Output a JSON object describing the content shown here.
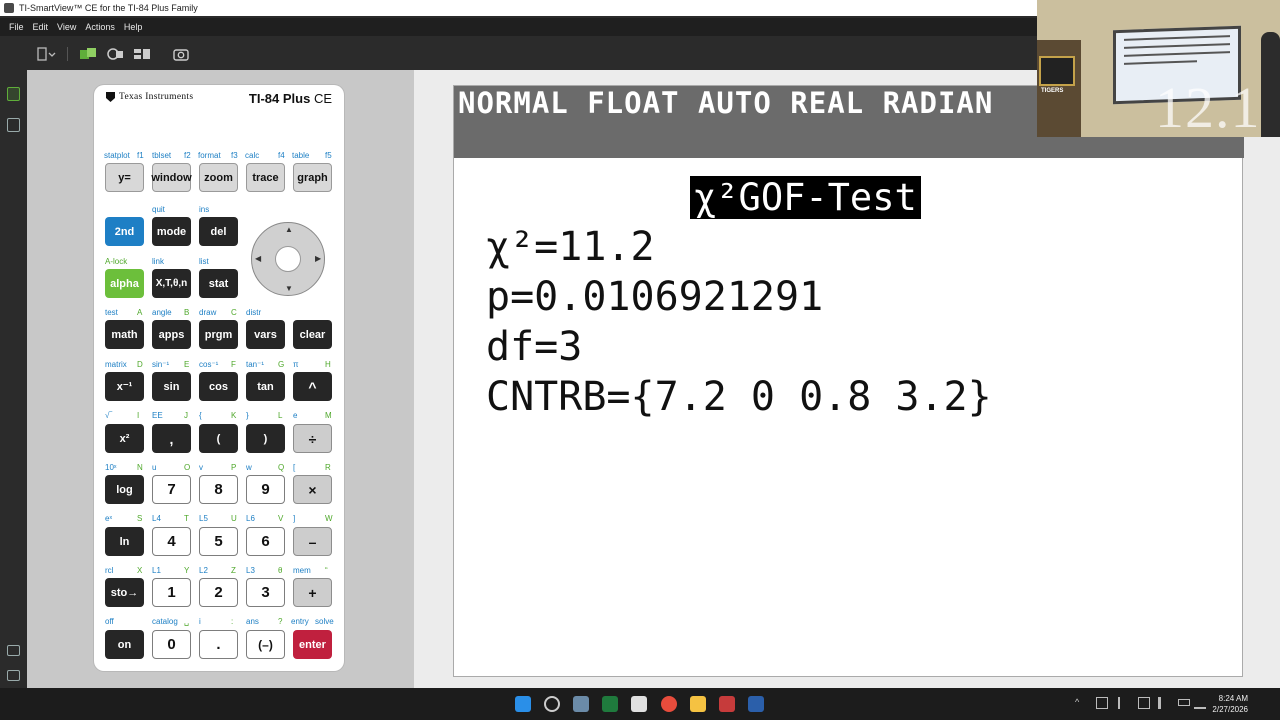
{
  "window": {
    "title": "TI-SmartView™ CE for the TI-84 Plus Family"
  },
  "menu": [
    "File",
    "Edit",
    "View",
    "Actions",
    "Help"
  ],
  "calculator": {
    "brand": "Texas Instruments",
    "model": "TI-84 Plus",
    "model_suffix": "CE",
    "keys": {
      "r1": [
        "y=",
        "window",
        "zoom",
        "trace",
        "graph"
      ],
      "r1_above": [
        "statplot",
        "f1",
        "tblset",
        "f2",
        "format",
        "f3",
        "calc",
        "f4",
        "table",
        "f5"
      ],
      "second": "2nd",
      "mode": "mode",
      "del": "del",
      "quit": "quit",
      "ins": "ins",
      "alpha": "alpha",
      "xton": "X,T,θ,n",
      "stat": "stat",
      "alock": "A-lock",
      "link": "link",
      "list": "list",
      "r4": [
        "math",
        "apps",
        "prgm",
        "vars",
        "clear"
      ],
      "r4_above": [
        "test",
        "A",
        "angle",
        "B",
        "draw",
        "C",
        "distr"
      ],
      "r5": [
        "x⁻¹",
        "sin",
        "cos",
        "tan",
        "^"
      ],
      "r5_above": [
        "matrix",
        "D",
        "sin⁻¹",
        "E",
        "cos⁻¹",
        "F",
        "tan⁻¹",
        "G",
        "π",
        "H"
      ],
      "r6": [
        "x²",
        ",",
        "(",
        ")",
        "÷"
      ],
      "r6_above": [
        "√‾",
        "I",
        "EE",
        "J",
        "{",
        "K",
        "}",
        "L",
        "e",
        "M"
      ],
      "r7": [
        "log",
        "7",
        "8",
        "9",
        "×"
      ],
      "r7_above": [
        "10ˣ",
        "N",
        "u",
        "O",
        "v",
        "P",
        "w",
        "Q",
        "[",
        "R"
      ],
      "r8": [
        "ln",
        "4",
        "5",
        "6",
        "–"
      ],
      "r8_above": [
        "eˣ",
        "S",
        "L4",
        "T",
        "L5",
        "U",
        "L6",
        "V",
        "]",
        "W"
      ],
      "r9": [
        "sto→",
        "1",
        "2",
        "3",
        "+"
      ],
      "r9_above": [
        "rcl",
        "X",
        "L1",
        "Y",
        "L2",
        "Z",
        "L3",
        "θ",
        "mem",
        "“"
      ],
      "r10": [
        "on",
        "0",
        ".",
        "(–)",
        "enter"
      ],
      "r10_above": [
        "off",
        "catalog",
        "␣",
        "i",
        ":",
        "ans",
        "?",
        "entry",
        "solve"
      ]
    }
  },
  "screen": {
    "status": "NORMAL FLOAT AUTO REAL RADIAN",
    "title": "χ²GOF-Test",
    "lines": [
      "χ²=11.2",
      "p=0.0106921291",
      "df=3",
      "CNTRB={7.2 0 0.8 3.2}"
    ]
  },
  "webcam": {
    "overlay_text": "12.1",
    "sign_text": "TIGERS"
  },
  "taskbar": {
    "time": "8:24 AM",
    "date": "2/27/2026"
  }
}
